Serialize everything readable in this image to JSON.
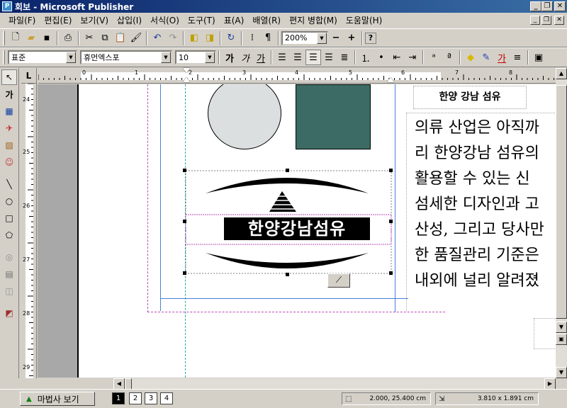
{
  "window": {
    "title": "회보 - Microsoft Publisher",
    "app_icon": "publisher-icon",
    "controls": [
      "_",
      "❐",
      "✕"
    ]
  },
  "menu": [
    "파일(F)",
    "편집(E)",
    "보기(V)",
    "삽입(I)",
    "서식(O)",
    "도구(T)",
    "표(A)",
    "배열(R)",
    "편지 병합(M)",
    "도움말(H)"
  ],
  "standard_toolbar": {
    "zoom": "200%",
    "zoom_out": "−",
    "zoom_in": "+"
  },
  "format_toolbar": {
    "style": "표준",
    "font": "휴먼엑스포",
    "size": "10",
    "bold_char": "가",
    "italic_char": "가",
    "underline_char": "가",
    "font_color_char": "가"
  },
  "rulers": {
    "horizontal_labels": [
      "1",
      "0",
      "1",
      "2",
      "3",
      "4",
      "5",
      "6",
      "7",
      "8",
      "9"
    ],
    "vertical_labels": [
      "24",
      "25",
      "26",
      "27",
      "28",
      "29"
    ],
    "corner_label": "L"
  },
  "document": {
    "header_box": "한양 강남 섬유",
    "logo_text": "한양강남섬유",
    "body_lines": [
      "의류 산업은 아직까",
      "리 한양강남 섬유의",
      "활용할 수 있는 신",
      "섬세한 디자인과 고",
      "산성, 그리고 당사만",
      "한 품질관리 기준은",
      "내외에 널리 알려졌"
    ],
    "colors": {
      "circle": "#dcdfe0",
      "square": "#3b6b64",
      "guide_blue": "#4a7fd8",
      "guide_magenta": "#b84cb8",
      "margin_cyan": "#2aa6a6"
    }
  },
  "status": {
    "wizard_label": "마법사 보기",
    "pages": [
      "1",
      "2",
      "3",
      "4"
    ],
    "active_page": "1",
    "position": "2.000, 25.400 cm",
    "size": "3.810 x 1.891 cm"
  }
}
